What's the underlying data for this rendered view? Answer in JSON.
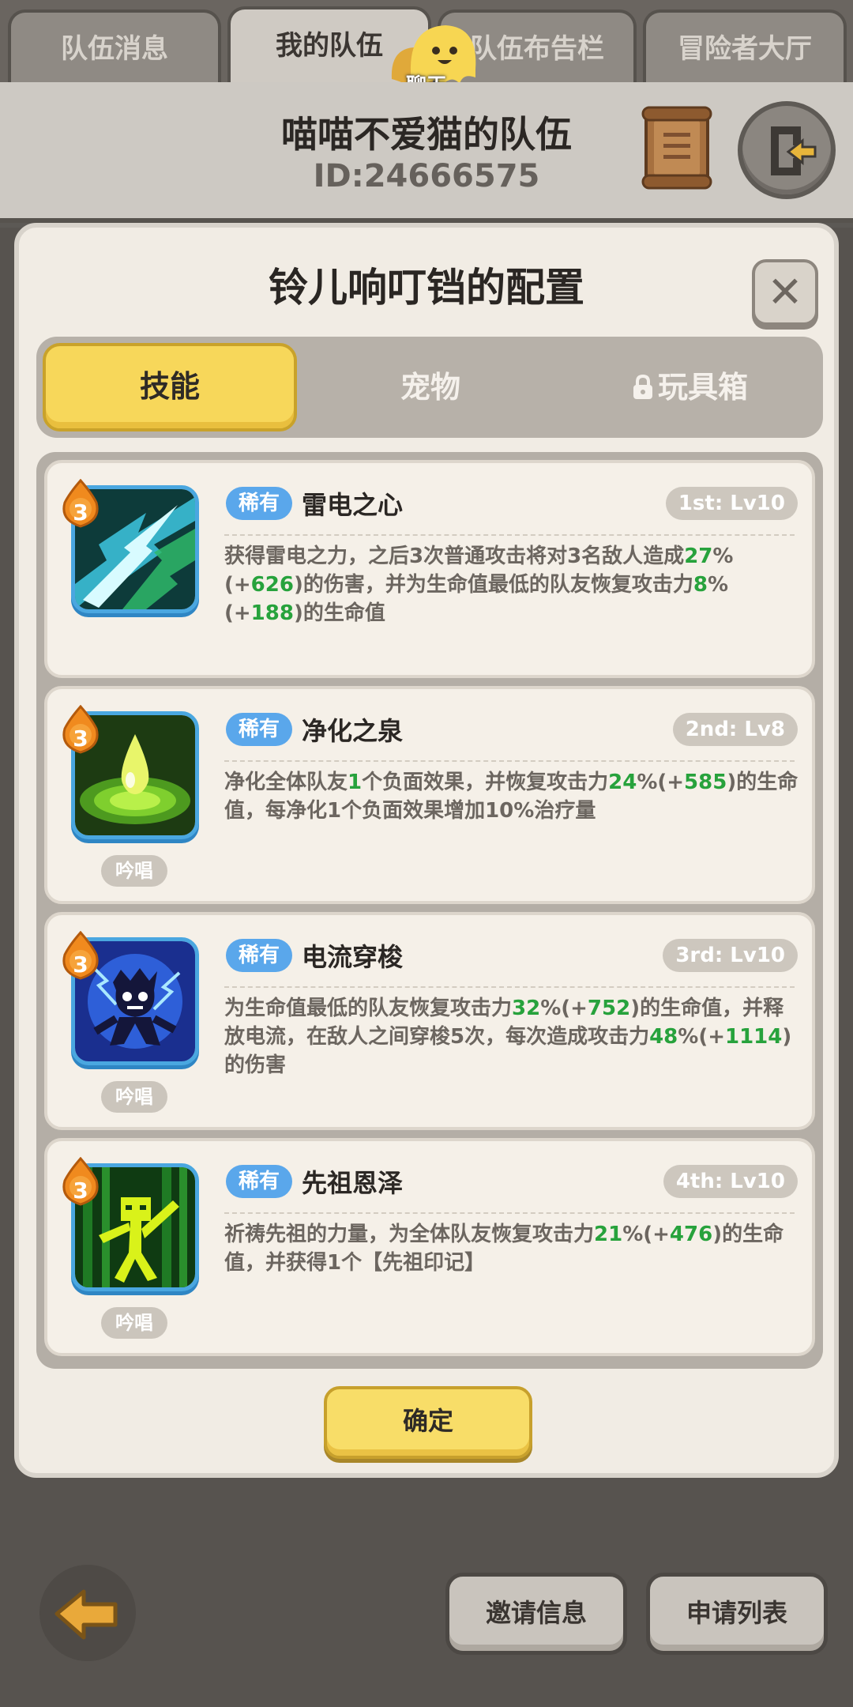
{
  "top_tabs": [
    "队伍消息",
    "我的队伍",
    "队伍布告栏",
    "冒险者大厅"
  ],
  "chat": {
    "label": "聊天"
  },
  "team": {
    "name": "喵喵不爱猫的队伍",
    "id": "ID:24666575"
  },
  "dialog": {
    "title": "铃儿响叮铛的配置",
    "close": "✕",
    "tabs": [
      "技能",
      "宠物",
      "玩具箱"
    ],
    "confirm_label": "确定"
  },
  "skills": [
    {
      "level": "3",
      "rarity": "稀有",
      "name": "雷电之心",
      "slot": "1st: Lv10",
      "chant": "",
      "desc": [
        {
          "t": "获得雷电之力，之后3次普通攻击将对3名敌人造成",
          "h": false
        },
        {
          "t": "27",
          "h": true
        },
        {
          "t": "%(+",
          "h": false
        },
        {
          "t": "626",
          "h": true
        },
        {
          "t": ")的伤害，并为生命值最低的队友恢复攻击力",
          "h": false
        },
        {
          "t": "8",
          "h": true
        },
        {
          "t": "%(+",
          "h": false
        },
        {
          "t": "188",
          "h": true
        },
        {
          "t": ")的生命值",
          "h": false
        }
      ]
    },
    {
      "level": "3",
      "rarity": "稀有",
      "name": "净化之泉",
      "slot": "2nd: Lv8",
      "chant": "吟唱",
      "desc": [
        {
          "t": "净化全体队友",
          "h": false
        },
        {
          "t": "1",
          "h": true
        },
        {
          "t": "个负面效果，并恢复攻击力",
          "h": false
        },
        {
          "t": "24",
          "h": true
        },
        {
          "t": "%(+",
          "h": false
        },
        {
          "t": "585",
          "h": true
        },
        {
          "t": ")的生命值，每净化1个负面效果增加10%治疗量",
          "h": false
        }
      ]
    },
    {
      "level": "3",
      "rarity": "稀有",
      "name": "电流穿梭",
      "slot": "3rd: Lv10",
      "chant": "吟唱",
      "desc": [
        {
          "t": "为生命值最低的队友恢复攻击力",
          "h": false
        },
        {
          "t": "32",
          "h": true
        },
        {
          "t": "%(+",
          "h": false
        },
        {
          "t": "752",
          "h": true
        },
        {
          "t": ")的生命值，并释放电流，在敌人之间穿梭5次，每次造成攻击力",
          "h": false
        },
        {
          "t": "48",
          "h": true
        },
        {
          "t": "%(+",
          "h": false
        },
        {
          "t": "1114",
          "h": true
        },
        {
          "t": ")的伤害",
          "h": false
        }
      ]
    },
    {
      "level": "3",
      "rarity": "稀有",
      "name": "先祖恩泽",
      "slot": "4th: Lv10",
      "chant": "吟唱",
      "desc": [
        {
          "t": "祈祷先祖的力量，为全体队友恢复攻击力",
          "h": false
        },
        {
          "t": "21",
          "h": true
        },
        {
          "t": "%(+",
          "h": false
        },
        {
          "t": "476",
          "h": true
        },
        {
          "t": ")的生命值，并获得1个【先祖印记】",
          "h": false
        }
      ]
    }
  ],
  "bottom": {
    "invite": "邀请信息",
    "applications": "申请列表"
  }
}
